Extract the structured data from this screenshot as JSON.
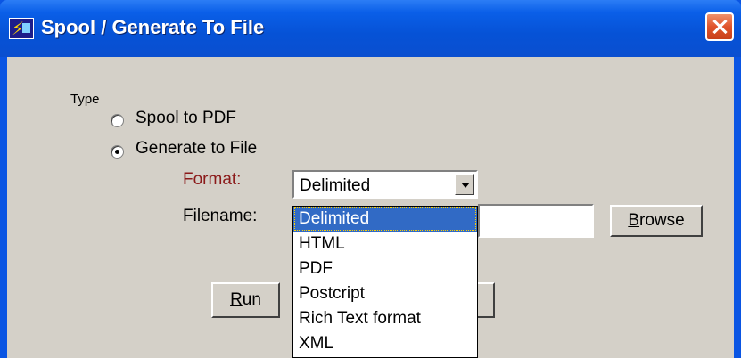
{
  "window": {
    "title": "Spool / Generate To File",
    "app_icon": "lightning-app-icon",
    "close_icon": "close-icon"
  },
  "type_group": {
    "label": "Type",
    "options": [
      {
        "label": "Spool to PDF",
        "checked": false
      },
      {
        "label": "Generate to File",
        "checked": true
      }
    ]
  },
  "format": {
    "label": "Format:",
    "value": "Delimited",
    "options": [
      "Delimited",
      "HTML",
      "PDF",
      "Postcript",
      "Rich Text format",
      "XML"
    ],
    "highlighted": "Delimited"
  },
  "filename": {
    "label": "Filename:",
    "value": ""
  },
  "buttons": {
    "browse_prefix": "B",
    "browse_rest": "rowse",
    "run_prefix": "R",
    "run_rest": "un"
  },
  "colors": {
    "title_bar": "#0a55e3",
    "dialog_bg": "#d4d0c8",
    "format_label": "#8b1a1a",
    "selection": "#316ac5"
  }
}
